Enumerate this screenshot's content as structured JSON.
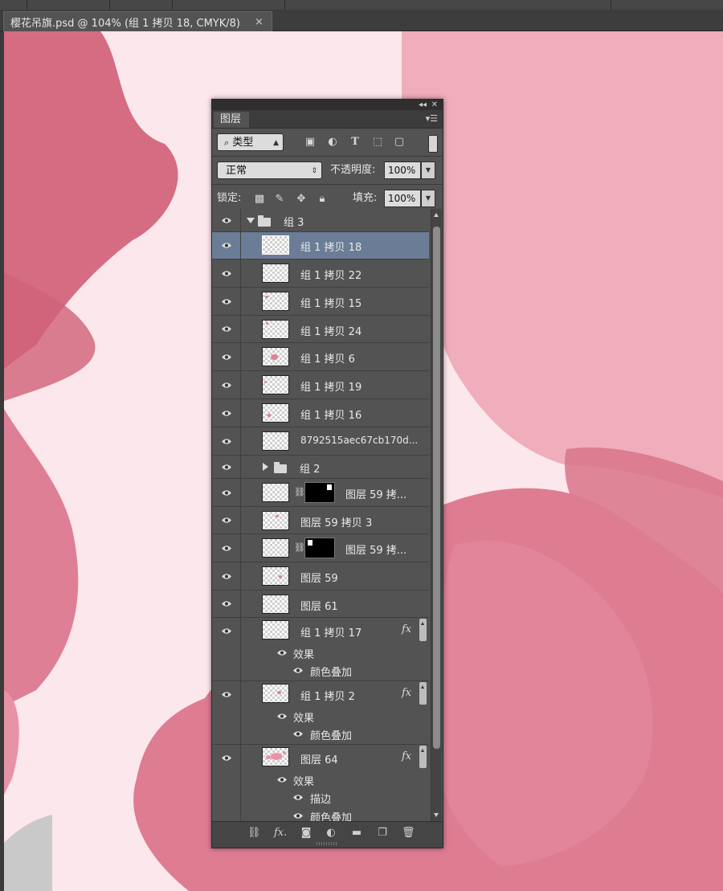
{
  "document_tab": {
    "title": "樱花吊旗.psd @ 104% (组 1 拷贝 18, CMYK/8)",
    "close": "×"
  },
  "panel": {
    "tab": "图层",
    "filter": {
      "kind": "类型"
    },
    "blend_mode": "正常",
    "opacity_label": "不透明度:",
    "opacity_value": "100%",
    "lock_label": "锁定:",
    "fill_label": "填充:",
    "fill_value": "100%",
    "layers": [
      {
        "name": "组 3",
        "type": "group",
        "expanded": true
      },
      {
        "name": "组 1 拷贝 18",
        "selected": true
      },
      {
        "name": "组 1 拷贝 22"
      },
      {
        "name": "组 1 拷贝 15"
      },
      {
        "name": "组 1 拷贝 24"
      },
      {
        "name": "组 1 拷贝 6"
      },
      {
        "name": "组 1 拷贝 19"
      },
      {
        "name": "组 1 拷贝 16"
      },
      {
        "name": "8792515aec67cb170d..."
      },
      {
        "name": "组 2",
        "type": "group",
        "expanded": false
      },
      {
        "name": "图层 59 拷...",
        "mask": true
      },
      {
        "name": "图层 59 拷贝 3"
      },
      {
        "name": "图层 59 拷...",
        "mask": true
      },
      {
        "name": "图层 59"
      },
      {
        "name": "图层 61"
      },
      {
        "name": "组 1 拷贝 17",
        "fx": "fx",
        "effects_label": "效果",
        "effects": [
          "颜色叠加"
        ]
      },
      {
        "name": "组 1 拷贝 2",
        "fx": "fx",
        "effects_label": "效果",
        "effects": [
          "颜色叠加"
        ]
      },
      {
        "name": "图层 64",
        "fx": "fx",
        "effects_label": "效果",
        "effects": [
          "描边",
          "颜色叠加"
        ]
      }
    ]
  },
  "colors": {
    "canvas_bg": "#fce7ec",
    "petal_dark": "#d56c82",
    "petal_mid": "#e58aa0",
    "petal_light": "#f0adbc",
    "selection": "#6b7d96"
  }
}
